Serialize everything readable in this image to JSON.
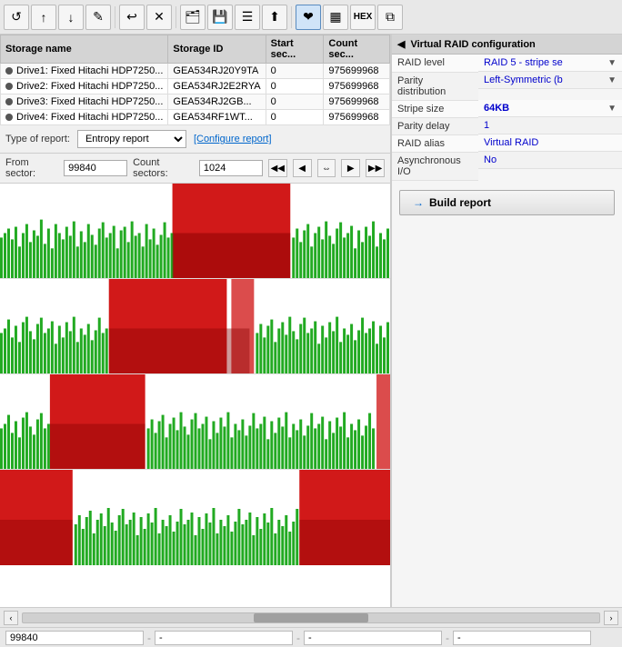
{
  "toolbar": {
    "buttons": [
      {
        "id": "tb-back",
        "icon": "↺",
        "label": "back"
      },
      {
        "id": "tb-up",
        "icon": "↑",
        "label": "up"
      },
      {
        "id": "tb-down",
        "icon": "↓",
        "label": "down"
      },
      {
        "id": "tb-edit",
        "icon": "✎",
        "label": "edit"
      },
      {
        "id": "tb-undo",
        "icon": "↩",
        "label": "undo"
      },
      {
        "id": "tb-cancel",
        "icon": "✕",
        "label": "cancel"
      },
      {
        "id": "tb-open",
        "icon": "📁",
        "label": "open"
      },
      {
        "id": "tb-save",
        "icon": "💾",
        "label": "save"
      },
      {
        "id": "tb-layers",
        "icon": "☰",
        "label": "layers"
      },
      {
        "id": "tb-export",
        "icon": "⬆",
        "label": "export"
      },
      {
        "id": "tb-heartbeat",
        "icon": "♥",
        "label": "heartbeat",
        "active": true
      },
      {
        "id": "tb-grid",
        "icon": "▦",
        "label": "grid"
      },
      {
        "id": "tb-hex",
        "icon": "HEX",
        "label": "hex"
      },
      {
        "id": "tb-copy",
        "icon": "⧉",
        "label": "copy"
      }
    ]
  },
  "drives": {
    "columns": [
      "Storage name",
      "Storage ID",
      "Start sec...",
      "Count sec..."
    ],
    "rows": [
      {
        "icon": "disk",
        "name": "Drive1: Fixed Hitachi HDP7250...",
        "id": "GEA534RJ20Y9TA",
        "start": "0",
        "count": "975699968"
      },
      {
        "icon": "disk",
        "name": "Drive2: Fixed Hitachi HDP7250...",
        "id": "GEA534RJ2E2RYA",
        "start": "0",
        "count": "975699968"
      },
      {
        "icon": "disk",
        "name": "Drive3: Fixed Hitachi HDP7250...",
        "id": "GEA534RJ2GB...",
        "start": "0",
        "count": "975699968"
      },
      {
        "icon": "disk",
        "name": "Drive4: Fixed Hitachi HDP7250...",
        "id": "GEA534RF1WT...",
        "start": "0",
        "count": "975699968"
      }
    ]
  },
  "report": {
    "type_label": "Type of report:",
    "type_value": "Entropy report",
    "config_link": "[Configure report]",
    "from_label": "From sector:",
    "from_value": "99840",
    "count_label": "Count sectors:",
    "count_value": "1024"
  },
  "raid_config": {
    "header": "Virtual RAID configuration",
    "rows": [
      {
        "label": "RAID level",
        "value": "RAID 5 - stripe se",
        "has_dropdown": true
      },
      {
        "label": "Parity distribution",
        "value": "Left-Symmetric (b",
        "has_dropdown": true
      },
      {
        "label": "Stripe size",
        "value": "64KB",
        "has_dropdown": true,
        "highlight": true
      },
      {
        "label": "Parity delay",
        "value": "1",
        "has_dropdown": false
      },
      {
        "label": "RAID alias",
        "value": "Virtual RAID",
        "has_dropdown": false
      },
      {
        "label": "Asynchronous I/O",
        "value": "No",
        "has_dropdown": false
      }
    ],
    "build_report_label": "Build report",
    "arrow_icon": "→"
  },
  "status_bar": {
    "field1": "99840",
    "field2": "-",
    "field3": "-",
    "field4": "-"
  },
  "scrollbar": {
    "left_arrow": "‹",
    "right_arrow": "›"
  }
}
